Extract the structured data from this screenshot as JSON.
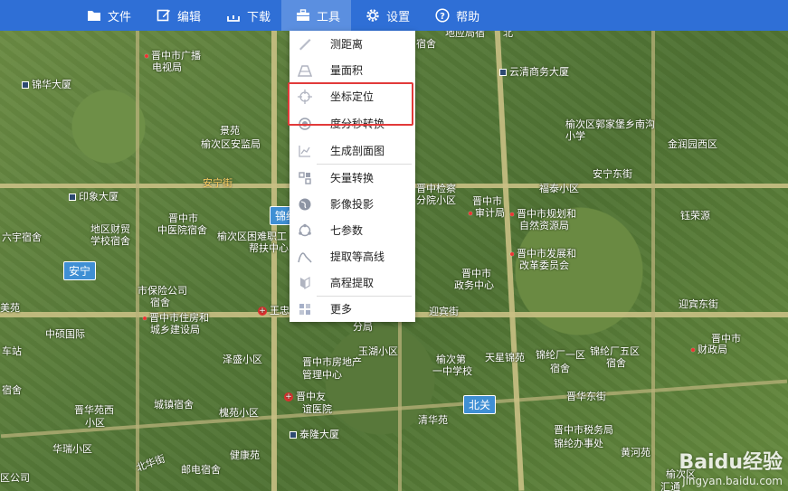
{
  "toolbar": {
    "items": [
      {
        "label": "文件",
        "icon": "folder-icon"
      },
      {
        "label": "编辑",
        "icon": "edit-icon"
      },
      {
        "label": "下载",
        "icon": "download-icon"
      },
      {
        "label": "工具",
        "icon": "toolbox-icon",
        "active": true
      },
      {
        "label": "设置",
        "icon": "gear-icon"
      },
      {
        "label": "帮助",
        "icon": "help-icon"
      }
    ]
  },
  "menu": {
    "items": [
      {
        "label": "测距离",
        "icon": "ruler-icon"
      },
      {
        "label": "量面积",
        "icon": "area-icon"
      },
      {
        "label": "坐标定位",
        "icon": "crosshair-icon"
      },
      {
        "label": "度分秒转换",
        "icon": "target-icon"
      },
      {
        "label": "生成剖面图",
        "icon": "profile-chart-icon"
      },
      {
        "label": "矢量转换",
        "icon": "vector-icon"
      },
      {
        "label": "影像投影",
        "icon": "globe-icon"
      },
      {
        "label": "七参数",
        "icon": "params-icon"
      },
      {
        "label": "提取等高线",
        "icon": "contour-icon"
      },
      {
        "label": "高程提取",
        "icon": "elevation-icon"
      },
      {
        "label": "更多",
        "icon": "grid-icon"
      }
    ]
  },
  "map": {
    "pois": [
      {
        "text": "晋中市广播",
        "type": "dot"
      },
      {
        "text": "电视局",
        "type": "none"
      },
      {
        "text": "锦华大厦",
        "type": "bld"
      },
      {
        "text": "云清商务大厦",
        "type": "bld"
      },
      {
        "text": "景苑",
        "type": "none"
      },
      {
        "text": "榆次区安监局",
        "type": "none"
      },
      {
        "text": "榆次区郭家堡乡南沟",
        "type": "none"
      },
      {
        "text": "小学",
        "type": "none"
      },
      {
        "text": "金润园西区",
        "type": "none"
      },
      {
        "text": "安宁东街",
        "type": "none"
      },
      {
        "text": "印象大厦",
        "type": "bld"
      },
      {
        "text": "晋中检察",
        "type": "none"
      },
      {
        "text": "分院小区",
        "type": "none"
      },
      {
        "text": "福泰小区",
        "type": "none"
      },
      {
        "text": "晋中市",
        "type": "none"
      },
      {
        "text": "审计局",
        "type": "dot"
      },
      {
        "text": "晋中市规划和",
        "type": "dot"
      },
      {
        "text": "自然资源局",
        "type": "none"
      },
      {
        "text": "钰荣源",
        "type": "none"
      },
      {
        "text": "晋中市",
        "type": "none"
      },
      {
        "text": "中医院宿舍",
        "type": "none"
      },
      {
        "text": "地区财贸",
        "type": "none"
      },
      {
        "text": "学校宿舍",
        "type": "none"
      },
      {
        "text": "六宇宿舍",
        "type": "none"
      },
      {
        "text": "榆次区困难职工",
        "type": "none"
      },
      {
        "text": "帮扶中心",
        "type": "none"
      },
      {
        "text": "晋中市发展和",
        "type": "dot"
      },
      {
        "text": "改革委员会",
        "type": "none"
      },
      {
        "text": "晋中市",
        "type": "none"
      },
      {
        "text": "政务中心",
        "type": "none"
      },
      {
        "text": "市保险公司",
        "type": "none"
      },
      {
        "text": "宿舍",
        "type": "none"
      },
      {
        "text": "迎宾东街",
        "type": "none"
      },
      {
        "text": "美苑",
        "type": "none"
      },
      {
        "text": "王忠",
        "type": "hosp"
      },
      {
        "text": "迎宾街",
        "type": "none"
      },
      {
        "text": "中硕国际",
        "type": "none"
      },
      {
        "text": "晋中市住房和",
        "type": "dot"
      },
      {
        "text": "城乡建设局",
        "type": "none"
      },
      {
        "text": "分局",
        "type": "none"
      },
      {
        "text": "晋中市",
        "type": "none"
      },
      {
        "text": "财政局",
        "type": "dot"
      },
      {
        "text": "车站",
        "type": "none"
      },
      {
        "text": "泽盛小区",
        "type": "none"
      },
      {
        "text": "晋中市房地产",
        "type": "none"
      },
      {
        "text": "管理中心",
        "type": "none"
      },
      {
        "text": "玉湖小区",
        "type": "none"
      },
      {
        "text": "榆次第",
        "type": "none"
      },
      {
        "text": "一中学校",
        "type": "none"
      },
      {
        "text": "天星锦苑",
        "type": "none"
      },
      {
        "text": "锦纶厂一区",
        "type": "none"
      },
      {
        "text": "宿舍",
        "type": "none"
      },
      {
        "text": "锦纶厂五区",
        "type": "none"
      },
      {
        "text": "宿舍",
        "type": "none"
      },
      {
        "text": "宿舍",
        "type": "none"
      },
      {
        "text": "晋华苑西",
        "type": "none"
      },
      {
        "text": "小区",
        "type": "none"
      },
      {
        "text": "城镇宿舍",
        "type": "none"
      },
      {
        "text": "晋中友",
        "type": "hosp"
      },
      {
        "text": "谊医院",
        "type": "none"
      },
      {
        "text": "晋华东街",
        "type": "none"
      },
      {
        "text": "槐苑小区",
        "type": "none"
      },
      {
        "text": "泰隆大厦",
        "type": "bld"
      },
      {
        "text": "清华苑",
        "type": "none"
      },
      {
        "text": "晋中市税务局",
        "type": "none"
      },
      {
        "text": "锦纶办事处",
        "type": "none"
      },
      {
        "text": "华瑞小区",
        "type": "none"
      },
      {
        "text": "健康苑",
        "type": "none"
      },
      {
        "text": "黄河苑",
        "type": "none"
      },
      {
        "text": "北华街",
        "type": "none"
      },
      {
        "text": "邮电宿舍",
        "type": "none"
      },
      {
        "text": "区公司",
        "type": "none"
      },
      {
        "text": "榆次区",
        "type": "none"
      },
      {
        "text": "汇通",
        "type": "none"
      }
    ],
    "tags": [
      {
        "text": "安宁"
      },
      {
        "text": "锦纶"
      },
      {
        "text": "北关"
      }
    ],
    "roads": [
      {
        "text": "安宁街"
      }
    ],
    "top_labels": [
      {
        "text": "宿舍"
      },
      {
        "text": "地应局宿"
      },
      {
        "text": "北"
      }
    ]
  },
  "watermark": {
    "brand": "Baidu经验",
    "url": "jingyan.baidu.com"
  },
  "colors": {
    "toolbar": "#2f6fd6",
    "toolbar_active": "#5b8fe0",
    "highlight": "#e23a3a"
  }
}
